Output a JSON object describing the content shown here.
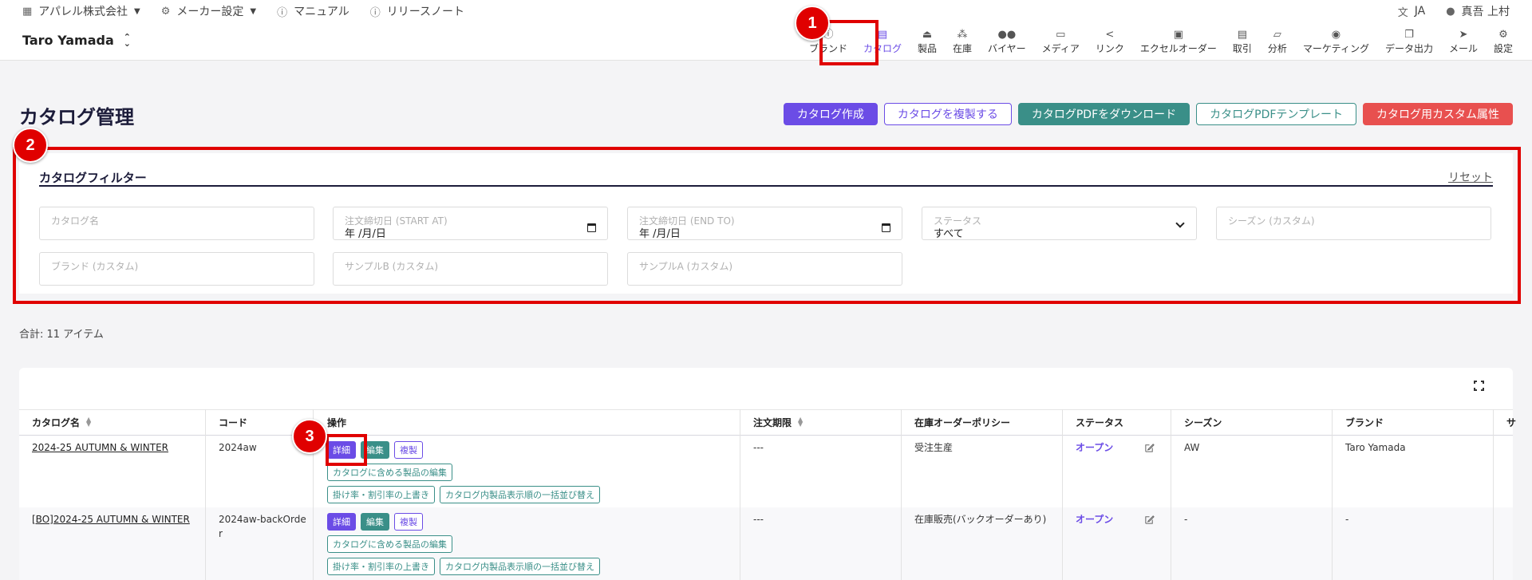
{
  "topbar": {
    "company": "アパレル株式会社",
    "maker_settings": "メーカー設定",
    "manual": "マニュアル",
    "release_notes": "リリースノート",
    "language": "JA",
    "user": "真吾 上村"
  },
  "header": {
    "brand_name": "Taro Yamada",
    "nav": [
      {
        "label": "ブランド",
        "icon": "info-icon"
      },
      {
        "label": "カタログ",
        "icon": "catalog-icon"
      },
      {
        "label": "製品",
        "icon": "hanger-icon"
      },
      {
        "label": "在庫",
        "icon": "boxes-icon"
      },
      {
        "label": "バイヤー",
        "icon": "people-icon"
      },
      {
        "label": "メディア",
        "icon": "cast-icon"
      },
      {
        "label": "リンク",
        "icon": "share-icon"
      },
      {
        "label": "エクセルオーダー",
        "icon": "excel-icon"
      },
      {
        "label": "取引",
        "icon": "chat-icon"
      },
      {
        "label": "分析",
        "icon": "chart-icon"
      },
      {
        "label": "マーケティング",
        "icon": "broadcast-icon"
      },
      {
        "label": "データ出力",
        "icon": "copy-icon"
      },
      {
        "label": "メール",
        "icon": "send-icon"
      },
      {
        "label": "設定",
        "icon": "gear-icon"
      }
    ]
  },
  "page": {
    "title": "カタログ管理",
    "buttons": {
      "create": "カタログ作成",
      "duplicate": "カタログを複製する",
      "download_pdf": "カタログPDFをダウンロード",
      "pdf_template": "カタログPDFテンプレート",
      "custom_attr": "カタログ用カスタム属性"
    }
  },
  "filter": {
    "title": "カタログフィルター",
    "reset": "リセット",
    "catalog_name": "カタログ名",
    "start_label": "注文締切日 (START AT)",
    "start_value": "年 /月/日",
    "end_label": "注文締切日 (END TO)",
    "end_value": "年 /月/日",
    "status_label": "ステータス",
    "status_value": "すべて",
    "season": "シーズン (カスタム)",
    "brand": "ブランド (カスタム)",
    "sampleB": "サンプルB (カスタム)",
    "sampleA": "サンプルA (カスタム)"
  },
  "total": "合計:  11 アイテム",
  "table": {
    "headers": {
      "name": "カタログ名",
      "code": "コード",
      "ops": "操作",
      "deadline": "注文期限",
      "policy": "在庫オーダーポリシー",
      "status": "ステータス",
      "season": "シーズン",
      "brand": "ブランド",
      "extra": "サ"
    },
    "op_labels": {
      "detail": "詳細",
      "edit": "編集",
      "copy": "複製",
      "edit_products": "カタログに含める製品の編集",
      "override_rate": "掛け率・割引率の上書き",
      "bulk_sort": "カタログ内製品表示順の一括並び替え"
    },
    "rows": [
      {
        "name": "2024-25 AUTUMN & WINTER",
        "code": "2024aw",
        "deadline": "---",
        "policy": "受注生産",
        "status": "オープン",
        "season": "AW",
        "brand": "Taro Yamada"
      },
      {
        "name": "[BO]2024-25 AUTUMN & WINTER",
        "code": "2024aw-backOrder",
        "deadline": "---",
        "policy": "在庫販売(バックオーダーあり)",
        "status": "オープン",
        "season": "-",
        "brand": "-"
      }
    ]
  },
  "annotations": [
    "1",
    "2",
    "3"
  ],
  "colors": {
    "accent": "#6b4ce6",
    "teal": "#3a8f88",
    "red": "#e8504f",
    "highlight": "#e00000"
  }
}
